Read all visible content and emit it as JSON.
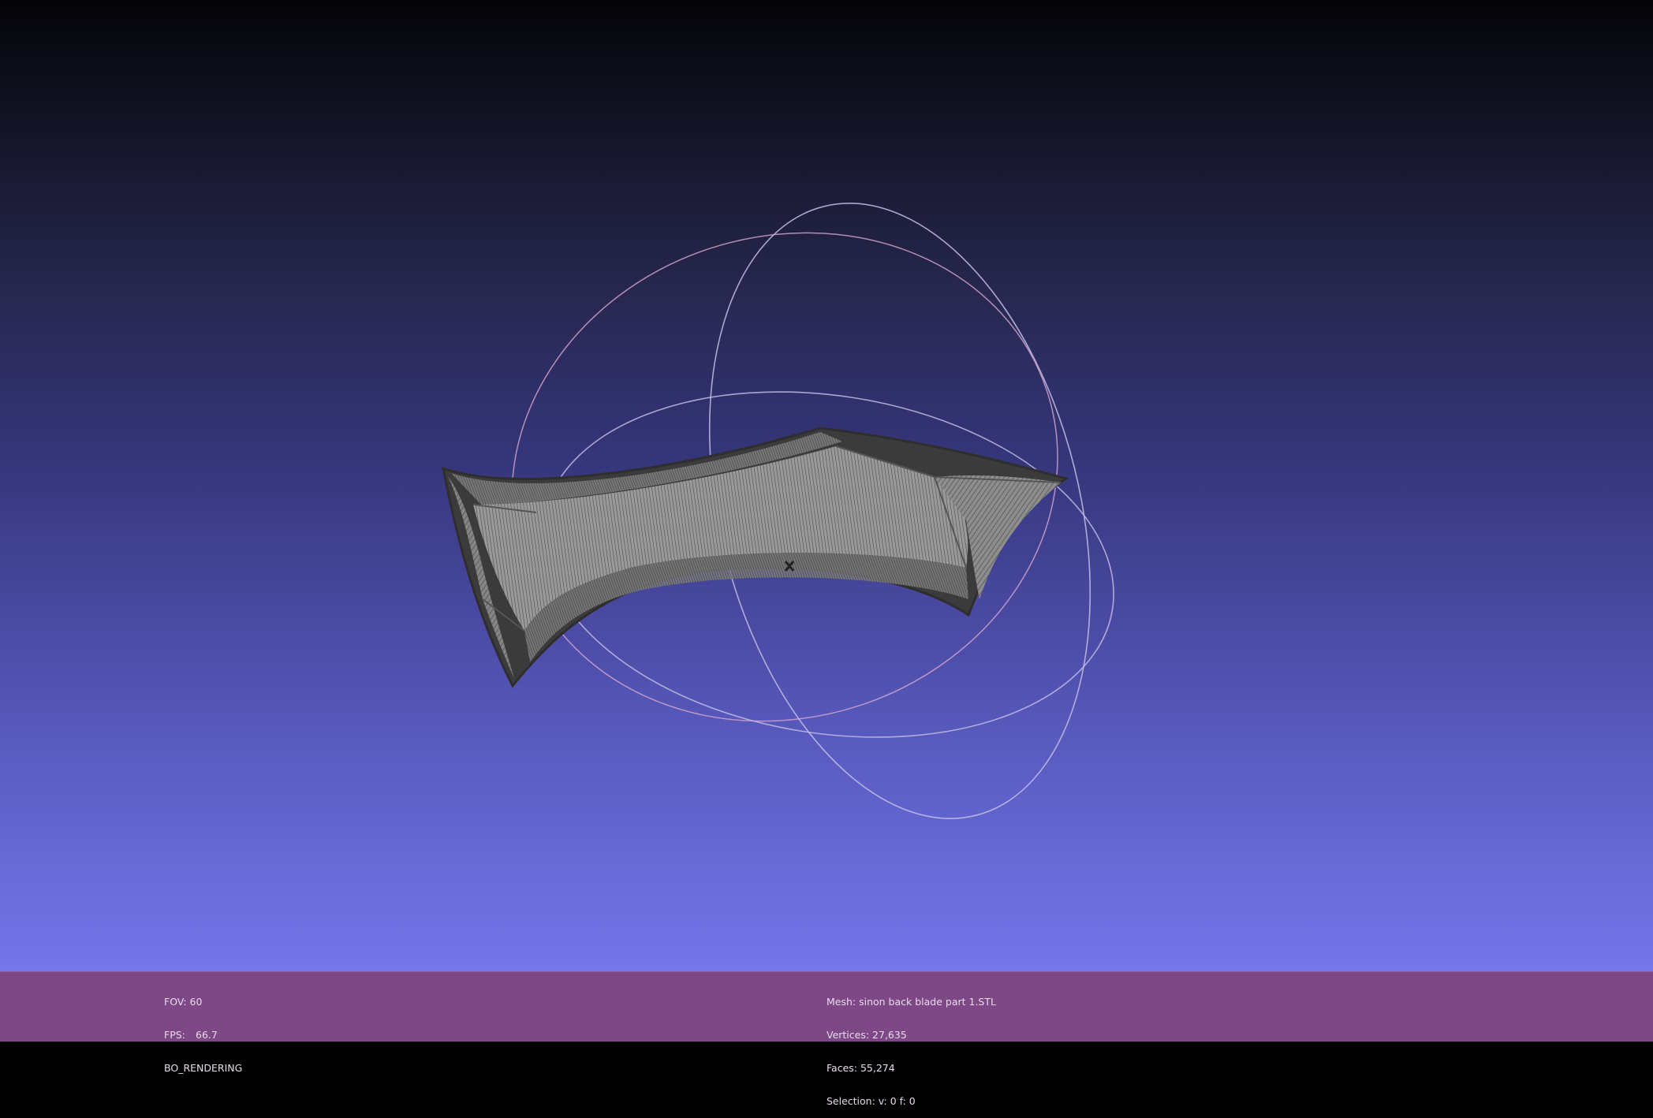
{
  "viewport": {
    "background_top": "#040408",
    "background_bottom": "#7476ea"
  },
  "info_left": {
    "fov": "FOV: 60",
    "fps_label": "FPS:",
    "fps_value": "66.7",
    "render_mode": "BO_RENDERING"
  },
  "info_right": {
    "mesh": "Mesh: sinon back blade part 1.STL",
    "vertices": "Vertices: 27,635",
    "faces": "Faces: 55,274",
    "selection": "Selection: v: 0 f: 0"
  },
  "colors": {
    "info_bar": "#7e4886",
    "mesh_edge": "#3a3a3a",
    "mesh_face": "#8c8c8c",
    "trackball_ring": "#c9c3e6"
  },
  "icons": [
    "trackball-icon"
  ]
}
